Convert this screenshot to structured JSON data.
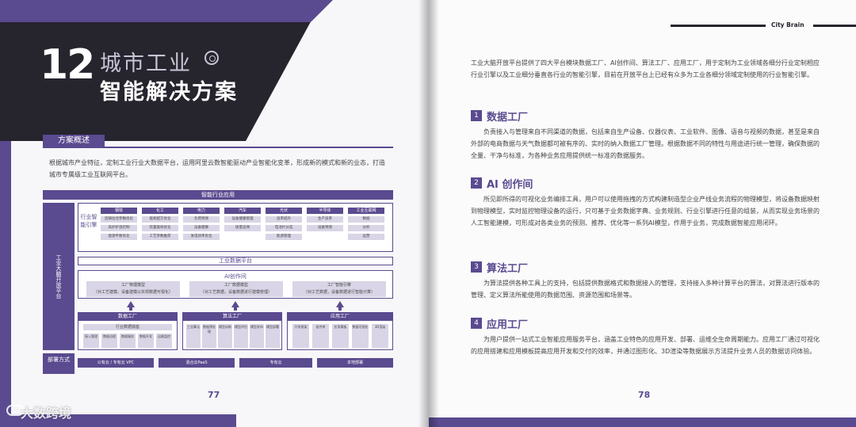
{
  "left_page": {
    "chapter_number": "12",
    "chapter_title_line1": "城市工业",
    "chapter_title_line2": "智能解决方案",
    "section_label": "方案概述",
    "intro": "根据城市产业特征，定制工业行业大数据平台，运用阿里云数智能驱动产业智能化变革，形成新的模式和新的业态，打造城市专属级工业互联网平台。",
    "page_number": "77",
    "watermark": "大数跨境",
    "diagram": {
      "top_label": "智能行业应用",
      "side_label": "工业大脑开放平台",
      "deploy_label": "部署方式",
      "industry_label": "行业智能引擎",
      "columns": [
        {
          "head": "钢铁",
          "items": [
            "连铸拉坯参数优化",
            "高炉炉温控制",
            "能源平衡优化"
          ]
        },
        {
          "head": "化工",
          "items": [
            "能耗配方优化",
            "装置能效优化",
            "工艺参数推荐"
          ]
        },
        {
          "head": "电力",
          "items": [
            "负荷预测",
            "设备健康",
            "发电效率优化"
          ]
        },
        {
          "head": "汽车",
          "items": [
            "设备健康管理",
            "质量追溯"
          ]
        },
        {
          "head": "光伏",
          "items": [
            "良率提升",
            "电池片分选",
            "能源管理"
          ]
        },
        {
          "head": "半导体",
          "items": [
            "生产良率",
            "设备预测"
          ]
        },
        {
          "head": "工业互联网",
          "items": [
            "数据",
            "分析",
            "运营"
          ]
        }
      ],
      "platform_label": "工业数据平台",
      "ai_title": "AI创作间",
      "ai_boxes": [
        {
          "title": "工厂物理模型",
          "sub": "（对工艺建模，设备建模以实现数据可视化）"
        },
        {
          "title": "工厂数据模型",
          "sub": "（对工艺数据，设备数据进行建模管理）"
        },
        {
          "title": "工厂智能引擎",
          "sub": "（对工艺数据，设备数据进行智能计算）"
        }
      ],
      "factories": [
        {
          "head": "数据工厂",
          "item": "行业数据底座",
          "subs": [
            "接入管理",
            "数据治理",
            "数据服务",
            "数据开发",
            "运维监控"
          ]
        },
        {
          "head": "算法工厂",
          "item": "",
          "subs": [
            "工业算法",
            "数据预处理",
            "模型训练",
            "模型评估",
            "模型发布",
            "模型部署"
          ]
        },
        {
          "head": "应用工厂",
          "item": "",
          "subs": [
            "开发框架",
            "组件库",
            "应用模板",
            "数据可视化",
            "3D渲染"
          ]
        }
      ],
      "deployments": [
        "公有云 / 专有云 VPC",
        "混合云PaaS",
        "专有云",
        "本地部署"
      ]
    }
  },
  "right_page": {
    "brand": "City Brain",
    "intro": "工业大脑开放平台提供了四大平台模块数据工厂、AI创作间、算法工厂、应用工厂，用于定制为工业领域各细分行业定制相应行业引擎以及工业细分垂直各行业的智能引擎，目前在开放平台上已经有众多为工业各细分领域定制使用的行业智能引擎。",
    "sections": [
      {
        "num": "1",
        "title": "数据工厂",
        "body": "负责接入与管理来自不同渠道的数据，包括来自生产设备、仪器仪表、工业软件、图像、语音与视频的数据，甚至是来自外部的电商数据与天气数据都可被有序的、实时的纳入数据工厂管理。根据数据不同的特性与用途进行统一管理，确保数据的全量、干净与标准，为各种业务应用提供统一标准的数据服务。"
      },
      {
        "num": "2",
        "title": "AI 创作间",
        "body": "所见即所得的可视化业务编排工具，用户可以使用拖拽的方式构建制造型企业产线业务流程的物理模型，将设备数据映射到物理模型，实时监控物理设备的运行，只可基于业务数据字典、业务规则、行业引擎进行任意的组装，从而实现业务场景的人工智能建模，可形成对各类业务的预测、推荐、优化等一系列AI模型，作用于业务，完成数据智能应用闭环。"
      },
      {
        "num": "3",
        "title": "算法工厂",
        "body": "为算法提供各种工具上的支持，包括提供数据格式和数据接入的管理，支持接入多种计算平台的算法，对算法进行版本的管理、定义算法所能使用的数据范围、资源范围和场景等。"
      },
      {
        "num": "4",
        "title": "应用工厂",
        "body": "为用户提供一站式工业智能应用服务平台，涵盖工业特色的应用开发、部署、运维全生命周期能力。应用工厂通过可视化的应用搭建和应用模板提高应用开发和交付的效率，并通过图形化、3D渲染等数据展示方法提升业务人员的数据访问体验。"
      }
    ],
    "page_number": "78"
  },
  "colors": {
    "accent": "#5a4a8f",
    "dark": "#26242d"
  }
}
